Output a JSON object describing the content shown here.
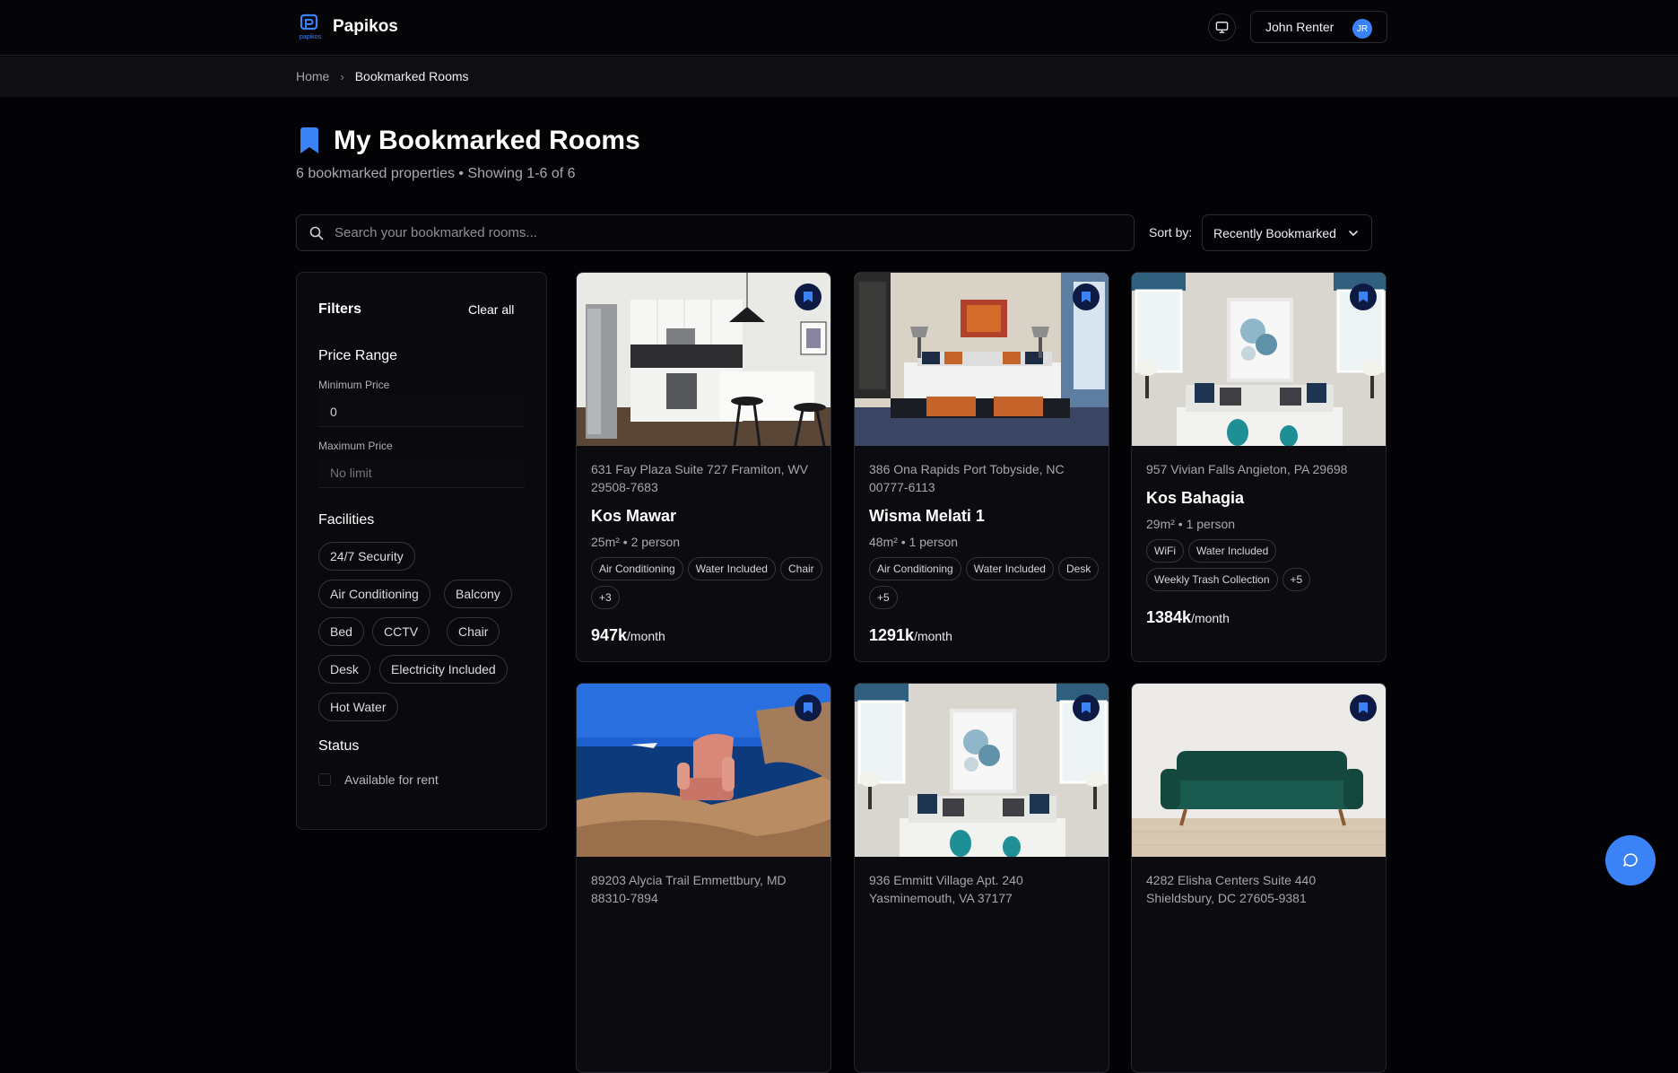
{
  "app": {
    "name": "Papikos",
    "logo_text": "papikos"
  },
  "topbar": {
    "user_name": "John Renter",
    "avatar_initials": "JR"
  },
  "breadcrumb": {
    "home": "Home",
    "separator": "›",
    "current": "Bookmarked Rooms"
  },
  "header": {
    "title": "My Bookmarked Rooms",
    "subtitle": "6 bookmarked properties • Showing 1-6 of 6"
  },
  "search": {
    "placeholder": "Search your bookmarked rooms...",
    "value": ""
  },
  "sort": {
    "label": "Sort by:",
    "selected": "Recently Bookmarked"
  },
  "filters": {
    "title": "Filters",
    "clear_all": "Clear all",
    "price_range": {
      "title": "Price Range",
      "min_label": "Minimum Price",
      "min_value": "0",
      "max_label": "Maximum Price",
      "max_value": "No limit"
    },
    "facilities": {
      "title": "Facilities",
      "items": [
        "24/7 Security",
        "Air Conditioning",
        "Balcony",
        "Bed",
        "CCTV",
        "Chair",
        "Desk",
        "Electricity Included",
        "Hot Water"
      ]
    },
    "status": {
      "title": "Status",
      "available_label": "Available for rent",
      "available_checked": false
    }
  },
  "rooms": [
    {
      "address": "631 Fay Plaza Suite 727 Framiton, WV 29508-7683",
      "name": "Kos Mawar",
      "meta": "25m² • 2 person",
      "tags": [
        "Air Conditioning",
        "Water Included",
        "Chair",
        "+3"
      ],
      "price": "947k",
      "price_unit": "/month",
      "image": "kitchen"
    },
    {
      "address": "386 Ona Rapids Port Tobyside, NC 00777-6113",
      "name": "Wisma Melati 1",
      "meta": "48m² • 1 person",
      "tags": [
        "Air Conditioning",
        "Water Included",
        "Desk",
        "+5"
      ],
      "price": "1291k",
      "price_unit": "/month",
      "image": "bedroom"
    },
    {
      "address": "957 Vivian Falls Angieton, PA 29698",
      "name": "Kos Bahagia",
      "meta": "29m² • 1 person",
      "tags": [
        "WiFi",
        "Water Included",
        "Weekly Trash Collection",
        "+5"
      ],
      "price": "1384k",
      "price_unit": "/month",
      "image": "living-room"
    },
    {
      "address": "89203 Alycia Trail Emmettbury, MD 88310-7894",
      "image": "armchair-on-cliff"
    },
    {
      "address": "936 Emmitt Village Apt. 240 Yasminemouth, VA 37177",
      "image": "living-room"
    },
    {
      "address": "4282 Elisha Centers Suite 440 Shieldsbury, DC 27605-9381",
      "image": "green-sofa"
    }
  ],
  "colors": {
    "accent": "#3b82f6",
    "background": "#030306",
    "card": "#0c0c10",
    "bookmark_bg": "#0d1a44"
  },
  "icons": [
    "bookmark-icon",
    "search-icon",
    "chevron-down-icon",
    "monitor-icon",
    "chat-icon"
  ]
}
